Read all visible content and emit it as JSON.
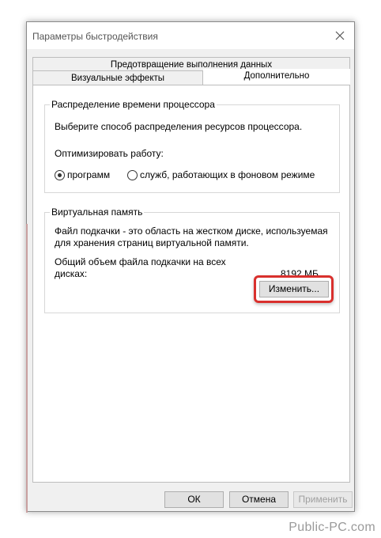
{
  "window": {
    "title": "Параметры быстродействия"
  },
  "tabs": [
    {
      "label": "Предотвращение выполнения данных"
    },
    {
      "label": "Визуальные эффекты"
    },
    {
      "label": "Дополнительно"
    }
  ],
  "processor": {
    "title": "Распределение времени процессора",
    "description": "Выберите способ распределения ресурсов процессора.",
    "optimize_label": "Оптимизировать работу:",
    "options": [
      {
        "label": "программ",
        "selected": true
      },
      {
        "label": "служб, работающих в фоновом режиме",
        "selected": false
      }
    ]
  },
  "virtual_memory": {
    "title": "Виртуальная память",
    "description_line1": "Файл подкачки - это область на жестком диске, используемая",
    "description_line2": "для хранения страниц виртуальной памяти.",
    "total_label_line1": "Общий объем файла подкачки на всех",
    "total_label_line2": "дисках:",
    "total_value": "8192 МБ",
    "change_button": "Изменить..."
  },
  "footer": {
    "ok": "ОК",
    "cancel": "Отмена",
    "apply": "Применить"
  },
  "watermark": "Public-PC.com",
  "colors": {
    "highlight": "#d9302d"
  }
}
